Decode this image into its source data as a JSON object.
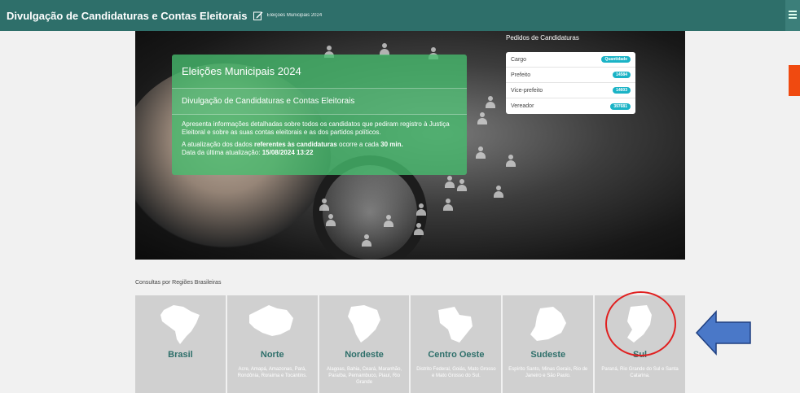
{
  "header": {
    "title": "Divulgação de Candidaturas e Contas Eleitorais",
    "subtitle": "Eleições Municipais 2024"
  },
  "hero": {
    "card_title": "Eleições Municipais 2024",
    "card_subtitle": "Divulgação de Candidaturas e Contas Eleitorais",
    "description": "Apresenta informações detalhadas sobre todos os candidatos que pediram registro à Justiça Eleitoral e sobre as suas contas eleitorais e as dos partidos políticos.",
    "update_prefix": "A atualização dos dados ",
    "update_bold": "referentes às candidaturas",
    "update_mid": " ocorre a cada ",
    "update_interval": "30 min.",
    "last_update_label": "Data da última atualização: ",
    "last_update_value": "15/08/2024 13:22"
  },
  "pedidos": {
    "title": "Pedidos de Candidaturas",
    "header_label": "Cargo",
    "header_badge": "Quantidade",
    "rows": [
      {
        "cargo": "Prefeito",
        "quantidade": "14584"
      },
      {
        "cargo": "Vice-prefeito",
        "quantidade": "14603"
      },
      {
        "cargo": "Vereador",
        "quantidade": "397681"
      }
    ]
  },
  "regions": {
    "title": "Consultas por Regiões Brasileiras",
    "items": [
      {
        "name": "Brasil",
        "states": ""
      },
      {
        "name": "Norte",
        "states": "Acre, Amapá, Amazonas, Pará, Rondônia, Roraima e Tocantins."
      },
      {
        "name": "Nordeste",
        "states": "Alagoas, Bahia, Ceará, Maranhão, Paraíba, Pernambuco, Piauí, Rio Grande"
      },
      {
        "name": "Centro Oeste",
        "states": "Distrito Federal, Goiás, Mato Grosso e Mato Grosso do Sul."
      },
      {
        "name": "Sudeste",
        "states": "Espírito Santo, Minas Gerais, Rio de Janeiro e São Paulo."
      },
      {
        "name": "Sul",
        "states": "Paraná, Rio Grande do Sul e Santa Catarina."
      }
    ]
  },
  "colors": {
    "header_bg": "#2e6f6a",
    "card_green": "#46be6e",
    "badge": "#1ab3c6",
    "annotation_red": "#e02020",
    "annotation_blue": "#4a78c8",
    "orange_accent": "#f04a10"
  }
}
